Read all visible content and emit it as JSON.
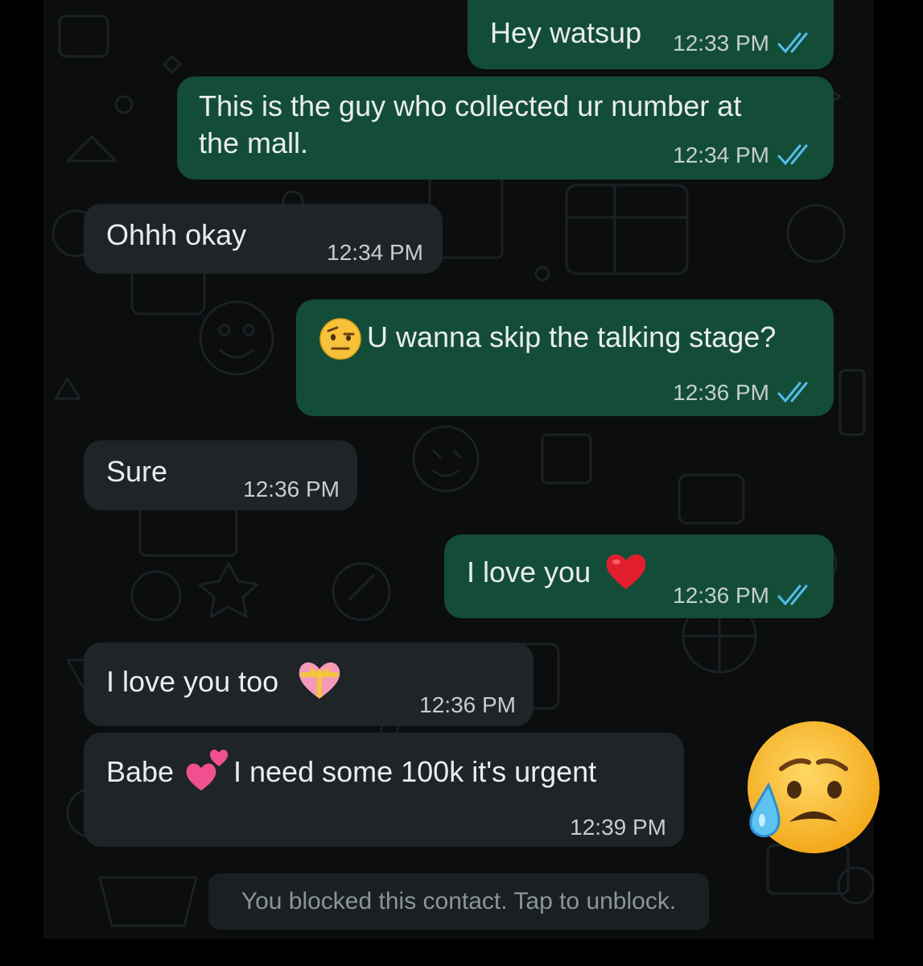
{
  "messages": [
    {
      "id": "m1",
      "direction": "out",
      "text": "Hey watsup",
      "time": "12:33 PM",
      "status": "read"
    },
    {
      "id": "m2",
      "direction": "out",
      "text": "This is the guy who collected ur number at\nthe mall.",
      "time": "12:34 PM",
      "status": "read"
    },
    {
      "id": "m3",
      "direction": "in",
      "text": "Ohhh okay",
      "time": "12:34 PM"
    },
    {
      "id": "m4",
      "direction": "out",
      "emoji": "face-with-raised-eyebrow",
      "text": "U wanna skip the talking stage?",
      "time": "12:36 PM",
      "status": "read"
    },
    {
      "id": "m5",
      "direction": "in",
      "text": "Sure",
      "time": "12:36 PM"
    },
    {
      "id": "m6",
      "direction": "out",
      "text": "I love you",
      "emoji": "red-heart",
      "time": "12:36 PM",
      "status": "read"
    },
    {
      "id": "m7",
      "direction": "in",
      "text": "I love you too",
      "emoji": "heart-with-ribbon",
      "time": "12:36 PM"
    },
    {
      "id": "m8",
      "direction": "in",
      "text_before": "Babe",
      "emoji": "two-hearts",
      "text_after": "I need some 100k it's urgent",
      "time": "12:39 PM"
    }
  ],
  "notice": "You blocked this contact. Tap to unblock.",
  "reaction_emoji": "sad-but-relieved-face",
  "colors": {
    "outgoing_bubble": "#144d37",
    "incoming_bubble": "#1f2426",
    "chat_background": "#0b0d0e",
    "read_ticks": "#53bdeb"
  }
}
